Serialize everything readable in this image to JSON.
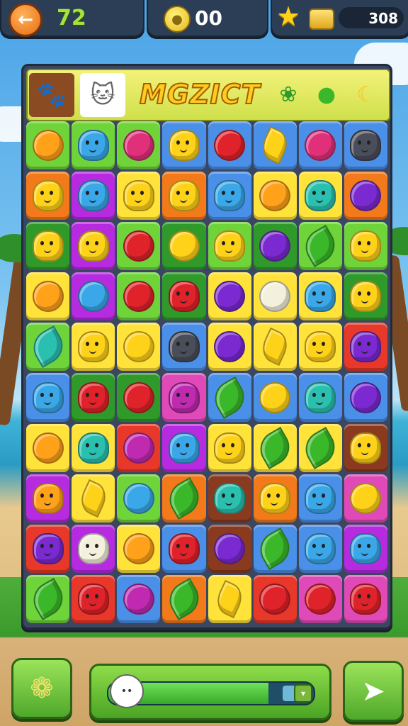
{
  "hud": {
    "moves": "72",
    "coins": "00",
    "score": "308",
    "back_icon": "back-arrow-icon",
    "coin_icon": "coin-icon",
    "star_icon": "star-icon"
  },
  "header": {
    "title": "MGZICT",
    "avatars": [
      "raccoon-avatar",
      "cat-avatar"
    ],
    "icons": [
      "leaf-icon",
      "pepper-icon",
      "banana-icon"
    ]
  },
  "board": {
    "colors": {
      "G": "#6fd43a",
      "D": "#2f9a2a",
      "B": "#4a8fe8",
      "Y": "#ffe23a",
      "O": "#f27a1a",
      "P": "#b62ae0",
      "R": "#e8382a",
      "K": "#8a3a1e",
      "M": "#e04ab8"
    },
    "piece_colors": {
      "orange": "#ffa21a",
      "blue": "#3aa7e8",
      "pink": "#e0307a",
      "yellow": "#ffd21a",
      "red": "#e0222a",
      "purple": "#7a2ad0",
      "gray": "#4a4e5a",
      "teal": "#2ac0b0",
      "green": "#3ab82a",
      "white": "#f4f0de",
      "magenta": "#c02ab0"
    },
    "rows": [
      [
        [
          "G",
          "orange",
          "fruit"
        ],
        [
          "G",
          "blue",
          "critter"
        ],
        [
          "G",
          "pink",
          "fruit"
        ],
        [
          "B",
          "yellow",
          "critter"
        ],
        [
          "B",
          "red",
          "fruit"
        ],
        [
          "B",
          "yellow",
          "banana"
        ],
        [
          "B",
          "pink",
          "fruit"
        ],
        [
          "B",
          "gray",
          "critter"
        ]
      ],
      [
        [
          "O",
          "yellow",
          "critter"
        ],
        [
          "P",
          "blue",
          "critter"
        ],
        [
          "Y",
          "yellow",
          "critter"
        ],
        [
          "O",
          "yellow",
          "critter"
        ],
        [
          "B",
          "blue",
          "critter"
        ],
        [
          "Y",
          "orange",
          "fruit"
        ],
        [
          "Y",
          "teal",
          "critter"
        ],
        [
          "O",
          "purple",
          "fruit"
        ]
      ],
      [
        [
          "D",
          "yellow",
          "critter"
        ],
        [
          "P",
          "yellow",
          "critter"
        ],
        [
          "G",
          "red",
          "fruit"
        ],
        [
          "D",
          "yellow",
          "fruit"
        ],
        [
          "G",
          "yellow",
          "critter"
        ],
        [
          "D",
          "purple",
          "fruit"
        ],
        [
          "G",
          "green",
          "leaf"
        ],
        [
          "G",
          "yellow",
          "critter"
        ]
      ],
      [
        [
          "Y",
          "orange",
          "fruit"
        ],
        [
          "P",
          "blue",
          "fruit"
        ],
        [
          "G",
          "red",
          "fruit"
        ],
        [
          "D",
          "red",
          "critter"
        ],
        [
          "Y",
          "purple",
          "fruit"
        ],
        [
          "Y",
          "white",
          "fruit"
        ],
        [
          "Y",
          "blue",
          "critter"
        ],
        [
          "D",
          "yellow",
          "critter"
        ]
      ],
      [
        [
          "G",
          "teal",
          "leaf"
        ],
        [
          "Y",
          "yellow",
          "critter"
        ],
        [
          "Y",
          "yellow",
          "fruit"
        ],
        [
          "B",
          "gray",
          "critter"
        ],
        [
          "Y",
          "purple",
          "fruit"
        ],
        [
          "Y",
          "yellow",
          "banana"
        ],
        [
          "Y",
          "yellow",
          "critter"
        ],
        [
          "R",
          "purple",
          "critter"
        ]
      ],
      [
        [
          "B",
          "blue",
          "critter"
        ],
        [
          "D",
          "red",
          "critter"
        ],
        [
          "D",
          "red",
          "fruit"
        ],
        [
          "M",
          "magenta",
          "critter"
        ],
        [
          "B",
          "green",
          "leaf"
        ],
        [
          "B",
          "yellow",
          "fruit"
        ],
        [
          "B",
          "teal",
          "critter"
        ],
        [
          "B",
          "purple",
          "fruit"
        ]
      ],
      [
        [
          "Y",
          "orange",
          "fruit"
        ],
        [
          "Y",
          "teal",
          "critter"
        ],
        [
          "R",
          "magenta",
          "fruit"
        ],
        [
          "P",
          "blue",
          "critter"
        ],
        [
          "Y",
          "yellow",
          "critter"
        ],
        [
          "Y",
          "green",
          "leaf"
        ],
        [
          "Y",
          "green",
          "leaf"
        ],
        [
          "K",
          "yellow",
          "critter"
        ]
      ],
      [
        [
          "P",
          "orange",
          "critter"
        ],
        [
          "Y",
          "yellow",
          "banana"
        ],
        [
          "G",
          "blue",
          "fruit"
        ],
        [
          "O",
          "green",
          "leaf"
        ],
        [
          "K",
          "teal",
          "critter"
        ],
        [
          "O",
          "yellow",
          "critter"
        ],
        [
          "B",
          "blue",
          "critter"
        ],
        [
          "M",
          "yellow",
          "fruit"
        ]
      ],
      [
        [
          "R",
          "purple",
          "critter"
        ],
        [
          "P",
          "white",
          "critter"
        ],
        [
          "Y",
          "orange",
          "fruit"
        ],
        [
          "B",
          "red",
          "critter"
        ],
        [
          "K",
          "purple",
          "fruit"
        ],
        [
          "B",
          "green",
          "leaf"
        ],
        [
          "B",
          "blue",
          "critter"
        ],
        [
          "P",
          "blue",
          "critter"
        ]
      ],
      [
        [
          "G",
          "green",
          "leaf"
        ],
        [
          "R",
          "red",
          "critter"
        ],
        [
          "B",
          "magenta",
          "fruit"
        ],
        [
          "O",
          "green",
          "leaf"
        ],
        [
          "Y",
          "yellow",
          "banana"
        ],
        [
          "R",
          "red",
          "fruit"
        ],
        [
          "M",
          "red",
          "fruit"
        ],
        [
          "M",
          "red",
          "critter"
        ]
      ]
    ]
  },
  "bottom": {
    "left_button_icon": "sun-critter-icon",
    "right_button_icon": "bone-icon",
    "progress_fraction": 0.78
  }
}
